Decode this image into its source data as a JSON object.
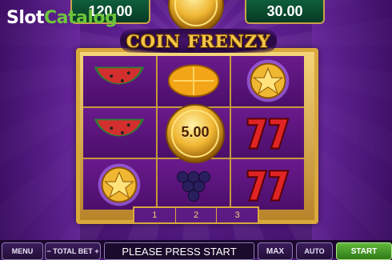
{
  "watermark": {
    "slot": "Slot",
    "catalog": "Catalog"
  },
  "jackpots": {
    "left_value": "120.00",
    "right_value": "30.00"
  },
  "logo": {
    "title": "COIN FRENZY"
  },
  "reels": [
    [
      "watermelon",
      "lemon",
      "coin"
    ],
    [
      "watermelon",
      "coin",
      "seven"
    ],
    [
      "coin",
      "grapes",
      "seven"
    ]
  ],
  "center_coin": {
    "value": "5.00"
  },
  "paylines": [
    "1",
    "2",
    "3"
  ],
  "controls": {
    "menu_label": "MENU",
    "minus": "−",
    "total_bet_label": "TOTAL BET",
    "plus": "+",
    "status_text": "PLEASE PRESS START",
    "max_label": "MAX",
    "auto_label": "AUTO",
    "start_label": "START"
  },
  "colors": {
    "frame_gold": "#d9a93c",
    "background_purple": "#5a1d8c",
    "start_green": "#5fb83a"
  }
}
